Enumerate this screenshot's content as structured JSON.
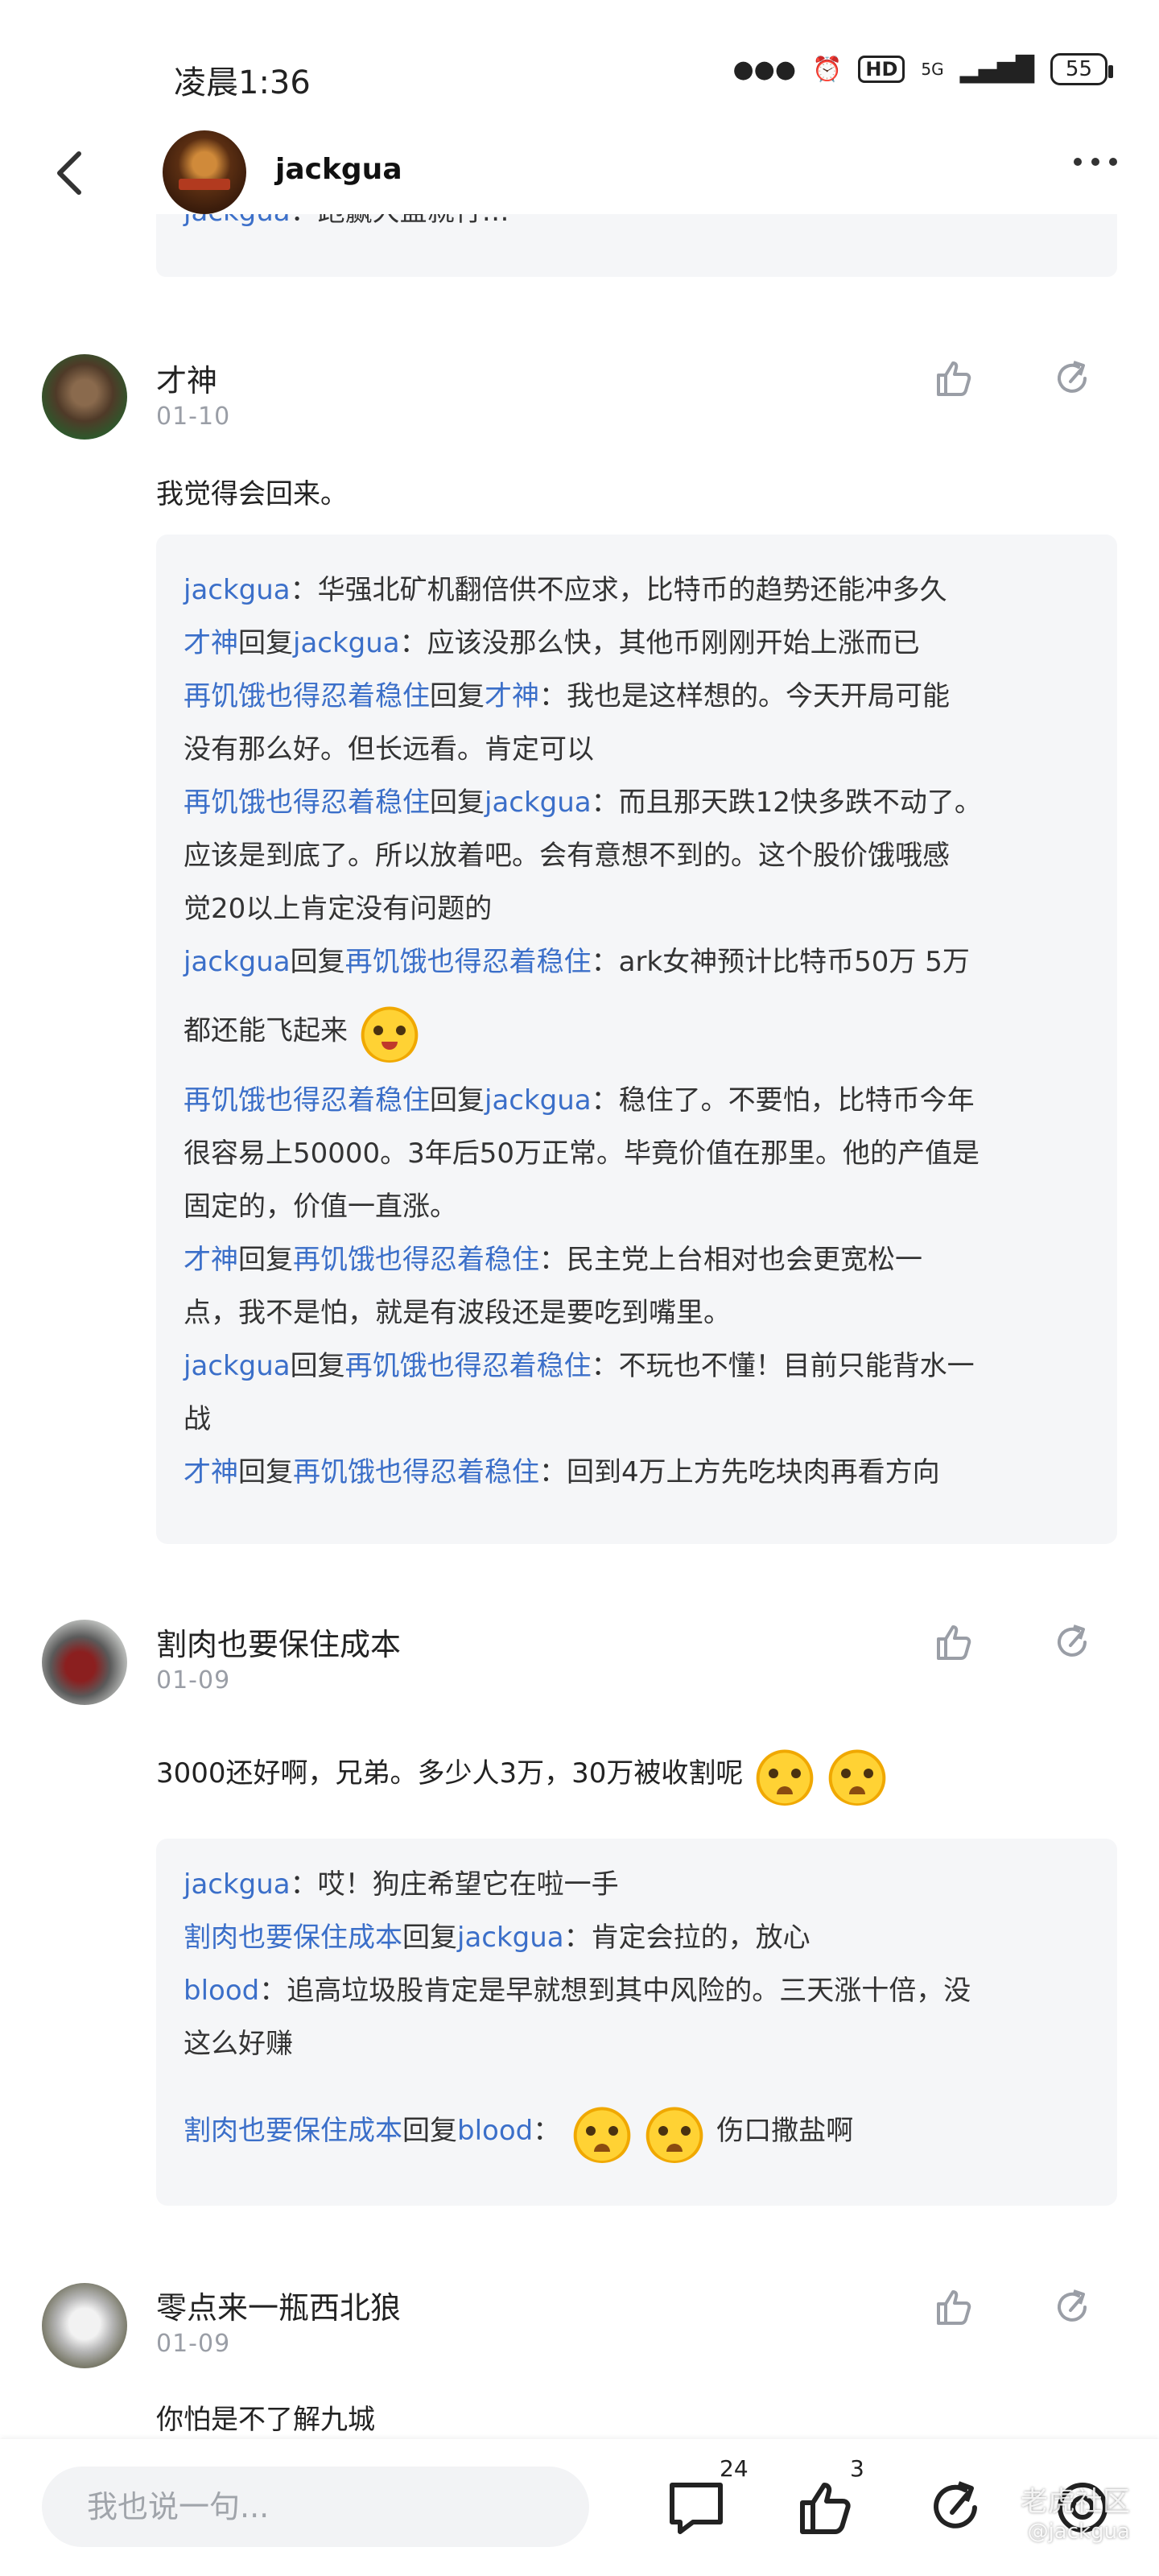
{
  "status": {
    "time": "凌晨1:36",
    "hd": "HD",
    "network": "5G",
    "battery": "55"
  },
  "header": {
    "name": "jackgua"
  },
  "top_reply": {
    "user": "jackgua",
    "text": "：跑赢大盘就行…"
  },
  "comments": [
    {
      "name": "才神",
      "date": "01-10",
      "text": "我觉得会回来。",
      "replies": {
        "l1u": "jackgua",
        "l1t": "：华强北矿机翻倍供不应求，比特币的趋势还能冲多久",
        "l2u1": "才神",
        "l2m": "回复",
        "l2u2": "jackgua",
        "l2t": "：应该没那么快，其他币刚刚开始上涨而已",
        "l3u1": "再饥饿也得忍着稳住",
        "l3m": "回复",
        "l3u2": "才神",
        "l3t": "：我也是这样想的。今天开局可能",
        "l4t": "没有那么好。但长远看。肯定可以",
        "l5u1": "再饥饿也得忍着稳住",
        "l5m": "回复",
        "l5u2": "jackgua",
        "l5t": "：而且那天跌12快多跌不动了。",
        "l6t": "应该是到底了。所以放着吧。会有意想不到的。这个股价饿哦感",
        "l7t": "觉20以上肯定没有问题的",
        "l8u1": "jackgua",
        "l8m": "回复",
        "l8u2": "再饥饿也得忍着稳住",
        "l8t": "：ark女神预计比特币50万  5万",
        "l9t": "都还能飞起来",
        "l10u1": "再饥饿也得忍着稳住",
        "l10m": "回复",
        "l10u2": "jackgua",
        "l10t": "：稳住了。不要怕，比特币今年",
        "l11t": "很容易上50000。3年后50万正常。毕竟价值在那里。他的产值是",
        "l12t": "固定的，价值一直涨。",
        "l13u1": "才神",
        "l13m": "回复",
        "l13u2": "再饥饿也得忍着稳住",
        "l13t": "：民主党上台相对也会更宽松一",
        "l14t": "点，我不是怕，就是有波段还是要吃到嘴里。",
        "l15u1": "jackgua",
        "l15m": "回复",
        "l15u2": "再饥饿也得忍着稳住",
        "l15t": "：不玩也不懂！目前只能背水一",
        "l16t": "战",
        "l17u1": "才神",
        "l17m": "回复",
        "l17u2": "再饥饿也得忍着稳住",
        "l17t": "：回到4万上方先吃块肉再看方向"
      }
    },
    {
      "name": "割肉也要保住成本",
      "date": "01-09",
      "text": "3000还好啊，兄弟。多少人3万，30万被收割呢",
      "replies": {
        "l1u": "jackgua",
        "l1t": "：哎！狗庄希望它在啦一手",
        "l2u1": "割肉也要保住成本",
        "l2m": "回复",
        "l2u2": "jackgua",
        "l2t": "：肯定会拉的，放心",
        "l3u": "blood",
        "l3t": "：追高垃圾股肯定是早就想到其中风险的。三天涨十倍，没",
        "l4t": "这么好赚",
        "l5u1": "割肉也要保住成本",
        "l5m": "回复",
        "l5u2": "blood",
        "l5t": "：",
        "l5end": "伤口撒盐啊"
      }
    },
    {
      "name": "零点来一瓶西北狼",
      "date": "01-09",
      "text": "你怕是不了解九城"
    }
  ],
  "bottom": {
    "placeholder": "我也说一句...",
    "comment_count": "24",
    "like_count": "3",
    "watermark": "老虎社区",
    "watermark_user": "@jackgua"
  },
  "colors": {
    "link": "#3b6fc9",
    "box_bg": "#f5f6f8",
    "meta": "#9a9ea6"
  }
}
